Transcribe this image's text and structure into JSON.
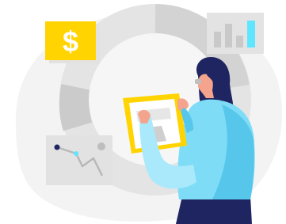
{
  "illustration": {
    "currency_symbol": "$",
    "icons": {
      "dollar_card": "dollar-sign-icon",
      "bar_chart_card": "bar-chart-icon",
      "line_chart_card": "line-chart-icon",
      "donut_ring": "donut-chart-icon",
      "person": "person-icon",
      "tablet": "tablet-icon"
    },
    "colors": {
      "background_blob": "#f2f2f2",
      "ring_light": "#e3e3e3",
      "ring_mid": "#d2d2d2",
      "ring_dark": "#c4c4c4",
      "card_gray": "#e0e0e0",
      "dollar_yellow": "#ffd400",
      "accent_cyan": "#5ee6ff",
      "shirt_cyan": "#7fdcf7",
      "shirt_shadow": "#56c7ea",
      "hair_navy": "#1e2561",
      "skin": "#f4a48c",
      "tablet_yellow": "#ffd400"
    }
  }
}
